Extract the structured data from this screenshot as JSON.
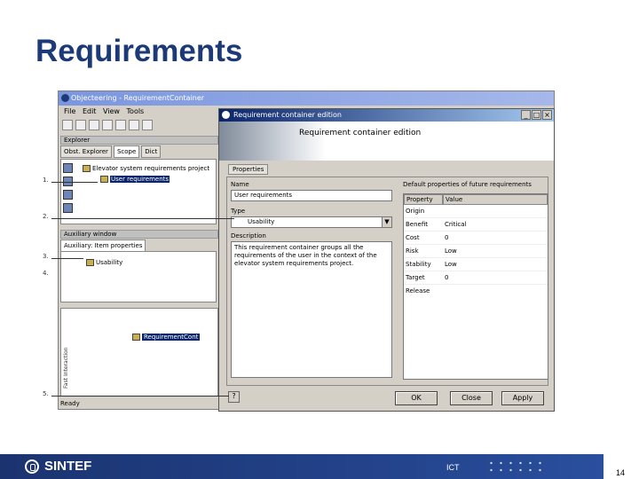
{
  "slide": {
    "title": "Requirements",
    "page": "14",
    "footer_text": "ICT",
    "logo_text": "SINTEF"
  },
  "app": {
    "title": "Objecteering - RequirementContainer",
    "menu": [
      "File",
      "Edit",
      "View",
      "Tools"
    ],
    "explorer_header": "Explorer",
    "explorer_tabs": [
      "Obst. Explorer",
      "Scope",
      "Dict"
    ],
    "tree": {
      "root": "Elevator system requirements project",
      "child": "User requirements"
    },
    "aux_header": "Auxiliary window",
    "aux_tab": "Auxiliary: Item properties",
    "aux_item": "Usability",
    "vertical_label": "Fast Interaction",
    "selected_item": "RequirementCont",
    "status": "Ready"
  },
  "dialog": {
    "title": "Requirement container edition",
    "banner_title": "Requirement container edition",
    "tab": "Properties",
    "name_label": "Name",
    "name_value": "User requirements",
    "type_label": "Type",
    "type_value": "Usability",
    "description_label": "Description",
    "description_value": "This requirement container groups all the requirements of the user in the context of the elevator system requirements project.",
    "defaults_label": "Default properties of future requirements",
    "table_headers": [
      "Property",
      "Value"
    ],
    "properties": [
      {
        "prop": "Origin",
        "value": ""
      },
      {
        "prop": "Benefit",
        "value": "Critical"
      },
      {
        "prop": "Cost",
        "value": "0"
      },
      {
        "prop": "Risk",
        "value": "Low"
      },
      {
        "prop": "Stability",
        "value": "Low"
      },
      {
        "prop": "Target Release",
        "value": "0"
      }
    ],
    "buttons": {
      "ok": "OK",
      "close": "Close",
      "apply": "Apply"
    }
  },
  "callouts": [
    "1.",
    "2.",
    "3.",
    "4.",
    "5."
  ]
}
